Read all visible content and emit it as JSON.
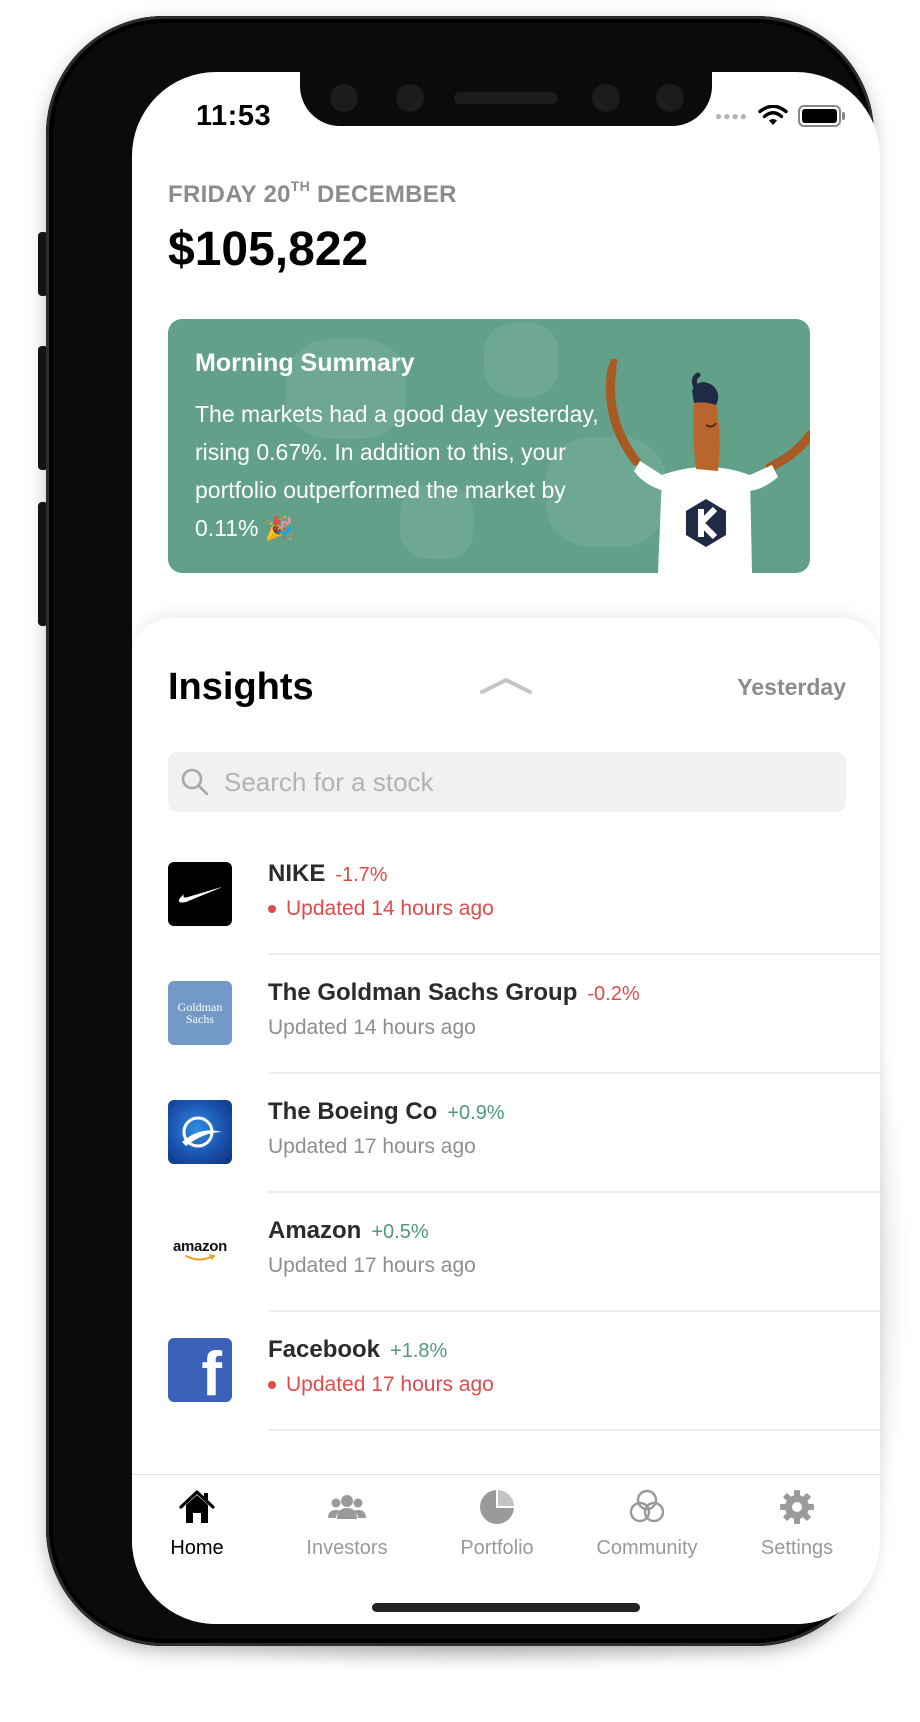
{
  "status": {
    "time": "11:53",
    "signal_icon": "signal-dots-icon",
    "wifi_icon": "wifi-icon",
    "battery_icon": "battery-icon"
  },
  "header": {
    "date_prefix": "FRIDAY 20",
    "date_suffix": "TH",
    "date_month": " DECEMBER",
    "balance": "$105,822"
  },
  "summary": {
    "title": "Morning Summary",
    "text": "The markets had a good day yesterday, rising 0.67%. In addition to this, your portfolio outperformed the market by 0.11% 🎉",
    "background_color": "#62a08a"
  },
  "insights": {
    "title": "Insights",
    "range_label": "Yesterday",
    "search_placeholder": "Search for a stock",
    "search_value": ""
  },
  "stocks": [
    {
      "name": "NIKE",
      "change": "-1.7%",
      "direction": "down",
      "updated": "Updated 14 hours ago",
      "alert": true,
      "logo_icon": "nike-logo-icon"
    },
    {
      "name": "The Goldman Sachs Group",
      "change": "-0.2%",
      "direction": "down",
      "updated": "Updated 14 hours ago",
      "alert": false,
      "logo_icon": "goldman-sachs-logo-icon",
      "logo_text": "Goldman Sachs"
    },
    {
      "name": "The Boeing Co",
      "change": "+0.9%",
      "direction": "up",
      "updated": "Updated 17 hours ago",
      "alert": false,
      "logo_icon": "boeing-logo-icon"
    },
    {
      "name": "Amazon",
      "change": "+0.5%",
      "direction": "up",
      "updated": "Updated 17 hours ago",
      "alert": false,
      "logo_icon": "amazon-logo-icon",
      "logo_text": "amazon"
    },
    {
      "name": "Facebook",
      "change": "+1.8%",
      "direction": "up",
      "updated": "Updated 17 hours ago",
      "alert": true,
      "logo_icon": "facebook-logo-icon",
      "logo_text": "f"
    }
  ],
  "tabs": [
    {
      "label": "Home",
      "icon": "home-icon",
      "active": true
    },
    {
      "label": "Investors",
      "icon": "investors-icon",
      "active": false
    },
    {
      "label": "Portfolio",
      "icon": "portfolio-pie-icon",
      "active": false
    },
    {
      "label": "Community",
      "icon": "community-icon",
      "active": false
    },
    {
      "label": "Settings",
      "icon": "gear-icon",
      "active": false
    }
  ],
  "colors": {
    "accent_green": "#62a08a",
    "negative_red": "#e24a4a",
    "positive_green": "#4f9a7a",
    "muted_gray": "#8e8e8e"
  }
}
